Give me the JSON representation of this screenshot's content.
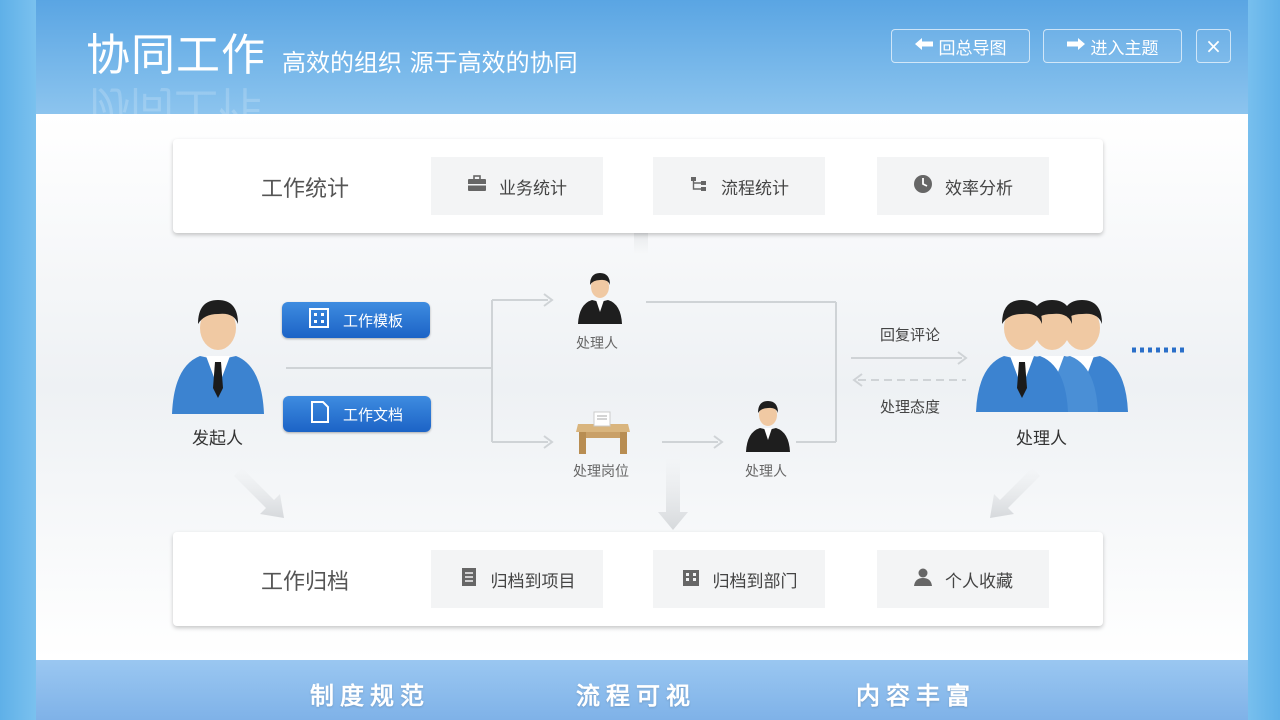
{
  "header": {
    "title": "协同工作",
    "subtitle": "高效的组织  源于高效的协同",
    "buttons": {
      "back": "回总导图",
      "enter": "进入主题",
      "close": "×"
    }
  },
  "stats_panel": {
    "title": "工作统计",
    "tiles": [
      {
        "label": "业务统计",
        "icon": "briefcase-icon"
      },
      {
        "label": "流程统计",
        "icon": "flow-icon"
      },
      {
        "label": "效率分析",
        "icon": "clock-icon"
      }
    ]
  },
  "flow": {
    "initiator_label": "发起人",
    "template_button": "工作模板",
    "document_button": "工作文档",
    "handler_top_label": "处理人",
    "post_label": "处理岗位",
    "handler_mid_label": "处理人",
    "reply_label": "回复评论",
    "attitude_label": "处理态度",
    "group_label": "处理人"
  },
  "archive_panel": {
    "title": "工作归档",
    "tiles": [
      {
        "label": "归档到项目",
        "icon": "document-icon"
      },
      {
        "label": "归档到部门",
        "icon": "building-icon"
      },
      {
        "label": "个人收藏",
        "icon": "person-icon"
      }
    ]
  },
  "footer": {
    "items": [
      "制度规范",
      "流程可视",
      "内容丰富"
    ]
  }
}
